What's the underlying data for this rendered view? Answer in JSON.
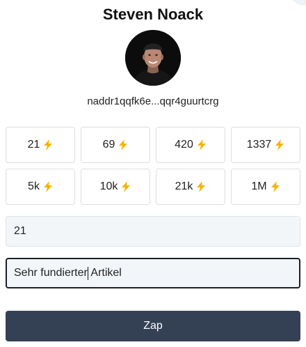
{
  "profile": {
    "name": "Steven Noack",
    "npub": "naddr1qqfk6e...qqr4guurtcrg",
    "avatar": "profile-photo"
  },
  "amount_buttons": [
    {
      "label": "21",
      "icon": "lightning-bolt-icon"
    },
    {
      "label": "69",
      "icon": "lightning-bolt-icon"
    },
    {
      "label": "420",
      "icon": "lightning-bolt-icon"
    },
    {
      "label": "1337",
      "icon": "lightning-bolt-icon"
    },
    {
      "label": "5k",
      "icon": "lightning-bolt-icon"
    },
    {
      "label": "10k",
      "icon": "lightning-bolt-icon"
    },
    {
      "label": "21k",
      "icon": "lightning-bolt-icon"
    },
    {
      "label": "1M",
      "icon": "lightning-bolt-icon"
    }
  ],
  "amount_input": {
    "value": "21"
  },
  "comment_input": {
    "value_before_cursor": "Sehr fundierter",
    "value_after_cursor": " Artikel"
  },
  "zap_button": {
    "label": "Zap"
  },
  "colors": {
    "bolt": "#f5b400",
    "primary_button": "#344155",
    "input_background": "#f3f6f9",
    "border": "#dadde2"
  }
}
